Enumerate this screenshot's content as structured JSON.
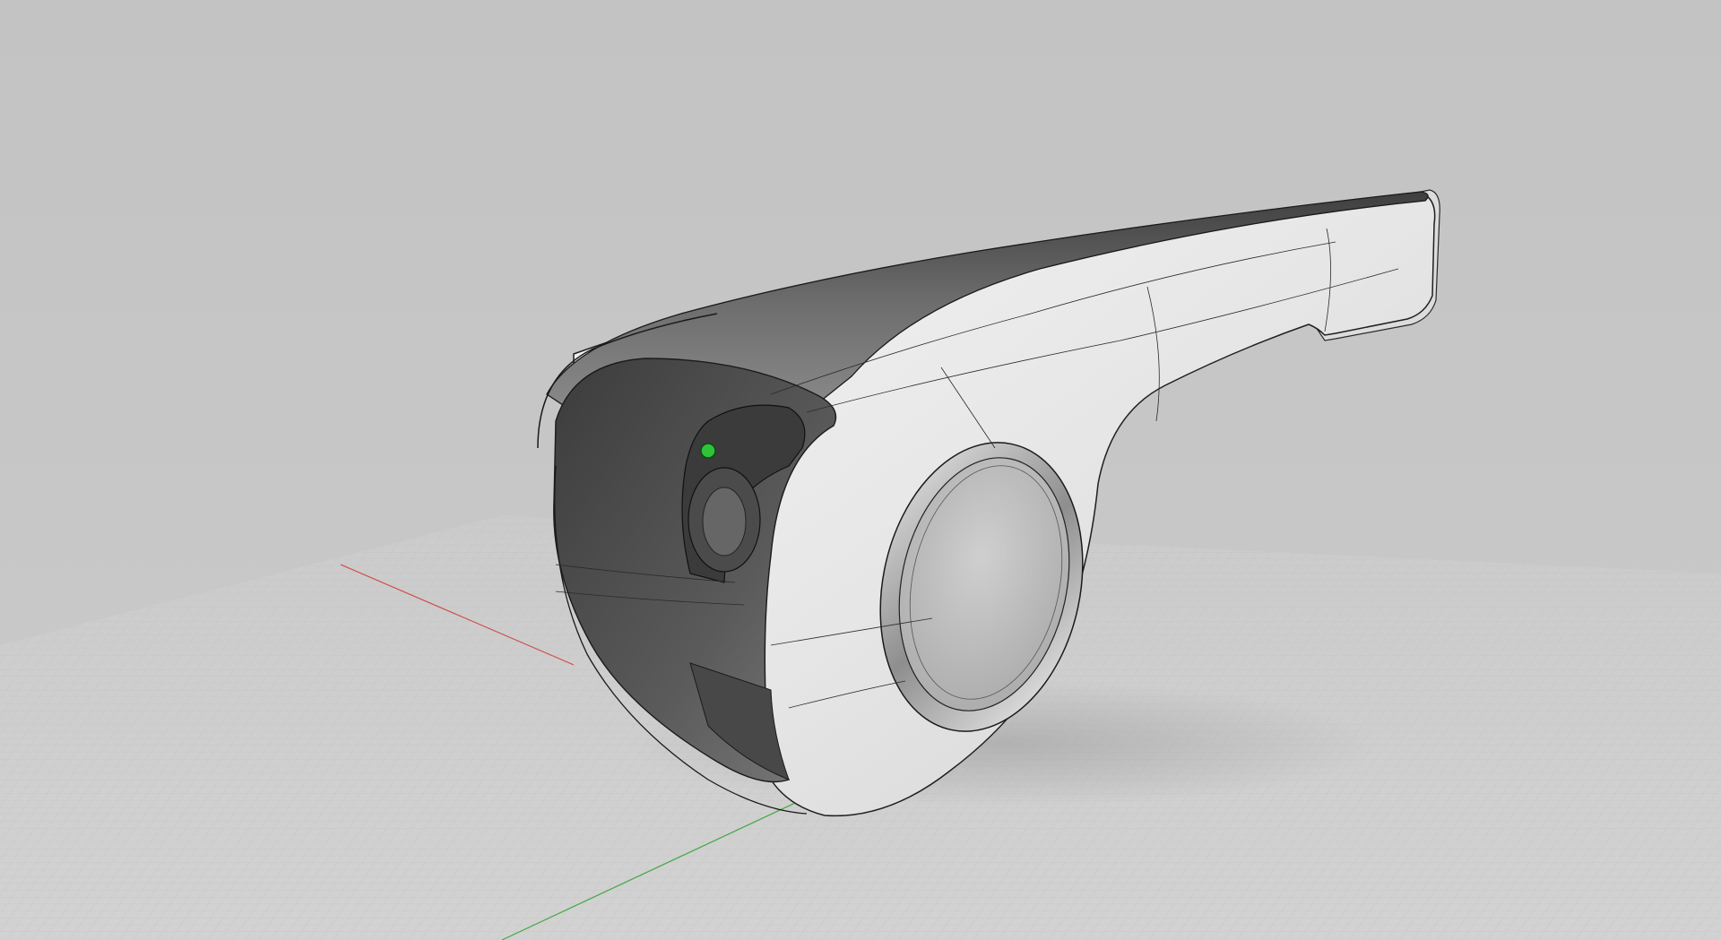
{
  "viewport": {
    "background_color": "#c6c6c6",
    "ground_color": "#cdcdcd",
    "grid_color": "#b8b8b8",
    "x_axis_color": "#d04040",
    "y_axis_color": "#3aa53a"
  },
  "model": {
    "body_color": "#e8e8e8",
    "shell_dark_color": "#5e5e5e",
    "indicator_color": "#2fc437",
    "edge_color": "#222222"
  }
}
